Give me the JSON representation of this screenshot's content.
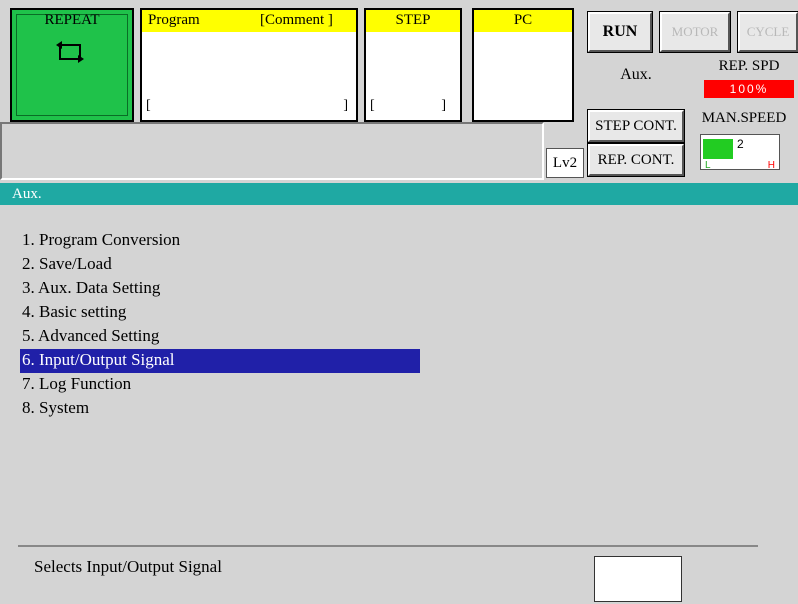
{
  "header": {
    "mode_label": "REPEAT",
    "program_label": "Program",
    "comment_label": "[Comment ]",
    "program_brackets": {
      "open": "[",
      "close": "]"
    },
    "step_label": "STEP",
    "step_brackets": {
      "open": "[",
      "close": "]"
    },
    "pc_label": "PC",
    "run_button": "RUN",
    "motor_button": "MOTOR",
    "cycle_button": "CYCLE",
    "aux_label": "Aux.",
    "rep_spd_label": "REP. SPD",
    "rep_spd_value": "100%",
    "step_cont_button": "STEP CONT.",
    "rep_cont_button": "REP. CONT.",
    "man_speed_label": "MAN.SPEED",
    "man_speed_value": "2",
    "man_speed_low": "L",
    "man_speed_high": "H",
    "man_speed_level": 0.4,
    "level_label": "Lv2"
  },
  "status_bar": {
    "title": "Aux."
  },
  "menu": {
    "items": [
      {
        "label": "1. Program Conversion"
      },
      {
        "label": "2. Save/Load"
      },
      {
        "label": "3. Aux. Data Setting"
      },
      {
        "label": "4. Basic setting"
      },
      {
        "label": "5. Advanced Setting"
      },
      {
        "label": "6. Input/Output Signal",
        "selected": true
      },
      {
        "label": "7. Log Function"
      },
      {
        "label": "8. System"
      }
    ]
  },
  "footer": {
    "message": "Selects Input/Output Signal"
  },
  "colors": {
    "repeat_green": "#1fc24a",
    "header_yellow": "#ffff00",
    "status_teal": "#1fa9a3",
    "selection_blue": "#2020a8",
    "speed_red": "#ff0000"
  }
}
